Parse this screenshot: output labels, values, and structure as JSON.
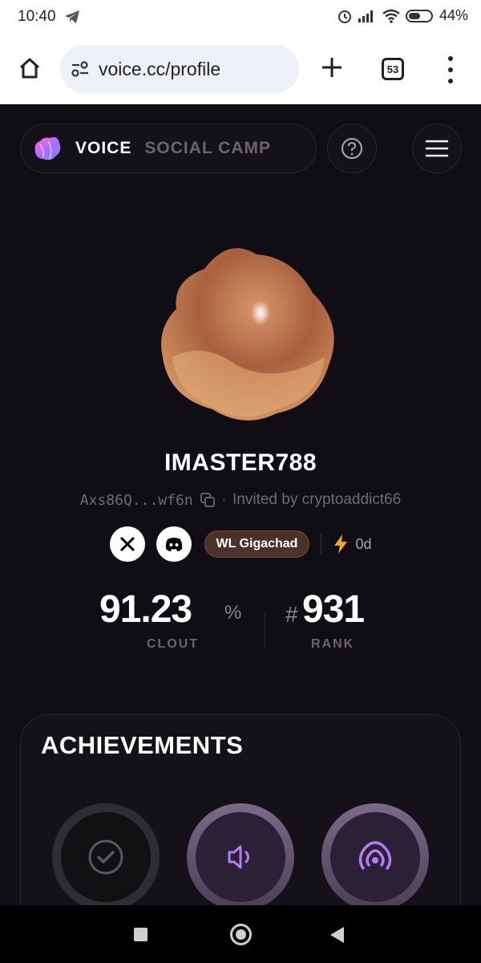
{
  "status_bar": {
    "time": "10:40",
    "battery": "44%"
  },
  "browser": {
    "url": "voice.cc/profile",
    "tab_count": "53"
  },
  "header": {
    "brand": "VOICE",
    "brand_sub": "SOCIAL CAMP"
  },
  "profile": {
    "username": "IMASTER788",
    "wallet": "Axs86Q...wf6n",
    "invited_by": "Invited by cryptoaddict66",
    "badge": "WL Gigachad",
    "streak": "0d"
  },
  "stats": {
    "clout_value": "91.23",
    "clout_unit": "%",
    "clout_label": "CLOUT",
    "rank_hash": "#",
    "rank_value": "931",
    "rank_label": "RANK"
  },
  "achievements": {
    "title": "ACHIEVEMENTS",
    "items": [
      {
        "icon": "check-circle-icon",
        "state": "locked"
      },
      {
        "icon": "speaker-icon",
        "state": "earned"
      },
      {
        "icon": "broadcast-icon",
        "state": "earned"
      }
    ]
  },
  "colors": {
    "background": "#110d14",
    "accent_purple": "#a66be6",
    "badge_brown": "#4c3029",
    "streak_orange": "#f5a623"
  }
}
